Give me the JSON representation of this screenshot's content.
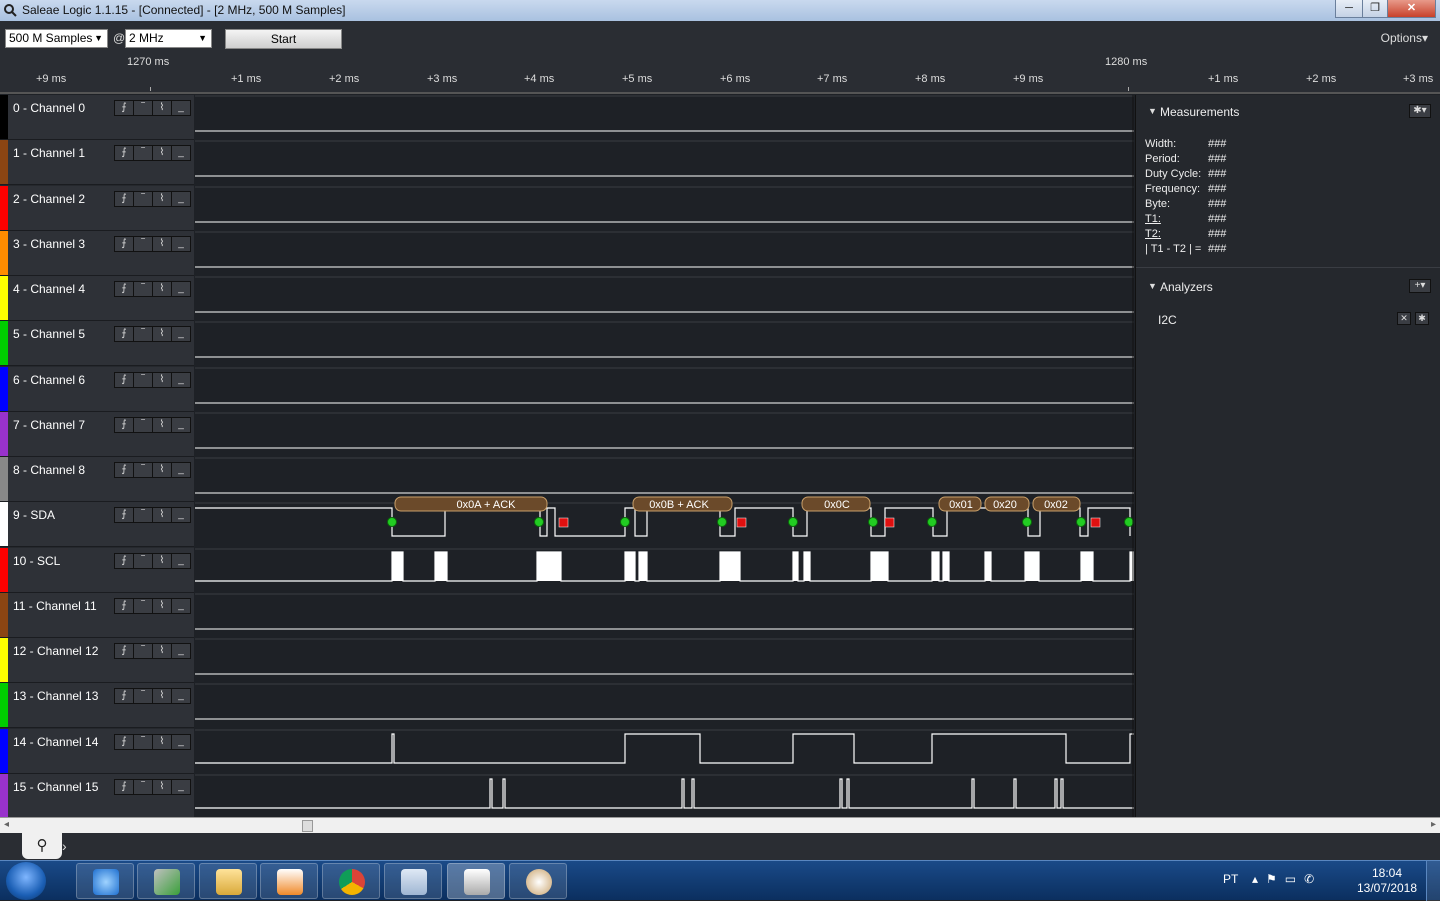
{
  "window": {
    "title": "Saleae Logic 1.1.15 - [Connected] - [2 MHz, 500 M Samples]",
    "minimize": "─",
    "maximize": "❐",
    "close": "✕"
  },
  "controls": {
    "samples_value": "500 M Samples",
    "at_label": "@",
    "rate_value": "2 MHz",
    "start_label": "Start",
    "options_label": "Options▾"
  },
  "ruler": {
    "major": [
      "1270 ms",
      "1280 ms"
    ],
    "minor": [
      "+9 ms",
      "+1 ms",
      "+2 ms",
      "+3 ms",
      "+4 ms",
      "+5 ms",
      "+6 ms",
      "+7 ms",
      "+8 ms",
      "+9 ms",
      "+1 ms",
      "+2 ms",
      "+3 ms"
    ]
  },
  "channels": [
    {
      "name": "0 - Channel 0",
      "color": "#000000"
    },
    {
      "name": "1 - Channel 1",
      "color": "#8b4513"
    },
    {
      "name": "2 - Channel 2",
      "color": "#ff0000"
    },
    {
      "name": "3 - Channel 3",
      "color": "#ff8c00"
    },
    {
      "name": "4 - Channel 4",
      "color": "#ffff00"
    },
    {
      "name": "5 - Channel 5",
      "color": "#00cc00"
    },
    {
      "name": "6 - Channel 6",
      "color": "#0000ff"
    },
    {
      "name": "7 - Channel 7",
      "color": "#9932cc"
    },
    {
      "name": "8 - Channel 8",
      "color": "#888888"
    },
    {
      "name": "9 - SDA",
      "color": "#ffffff"
    },
    {
      "name": "10 - SCL",
      "color": "#ff0000"
    },
    {
      "name": "11 - Channel 11",
      "color": "#8b4513"
    },
    {
      "name": "12 - Channel 12",
      "color": "#ffff00"
    },
    {
      "name": "13 - Channel 13",
      "color": "#00cc00"
    },
    {
      "name": "14 - Channel 14",
      "color": "#0000ff"
    },
    {
      "name": "15 - Channel 15",
      "color": "#9932cc"
    }
  ],
  "trigger_buttons": [
    "⨍",
    "‾",
    "⌇",
    "_"
  ],
  "decoded": {
    "labels": [
      "0x0A + ACK",
      "0x0B + ACK",
      "0x0C",
      "0x01",
      "0x20",
      "0x02"
    ]
  },
  "measurements": {
    "title": "Measurements",
    "rows": [
      {
        "label": "Width:",
        "value": "###"
      },
      {
        "label": "Period:",
        "value": "###"
      },
      {
        "label": "Duty Cycle:",
        "value": "###"
      },
      {
        "label": "Frequency:",
        "value": "###"
      },
      {
        "label": "Byte:",
        "value": "###"
      },
      {
        "label": "T1:",
        "value": "###"
      },
      {
        "label": "T2:",
        "value": "###"
      },
      {
        "label": "| T1 - T2 | =",
        "value": "###"
      }
    ]
  },
  "analyzers": {
    "title": "Analyzers",
    "items": [
      "I2C"
    ]
  },
  "taskbar": {
    "lang": "PT",
    "time": "18:04",
    "date": "13/07/2018"
  }
}
